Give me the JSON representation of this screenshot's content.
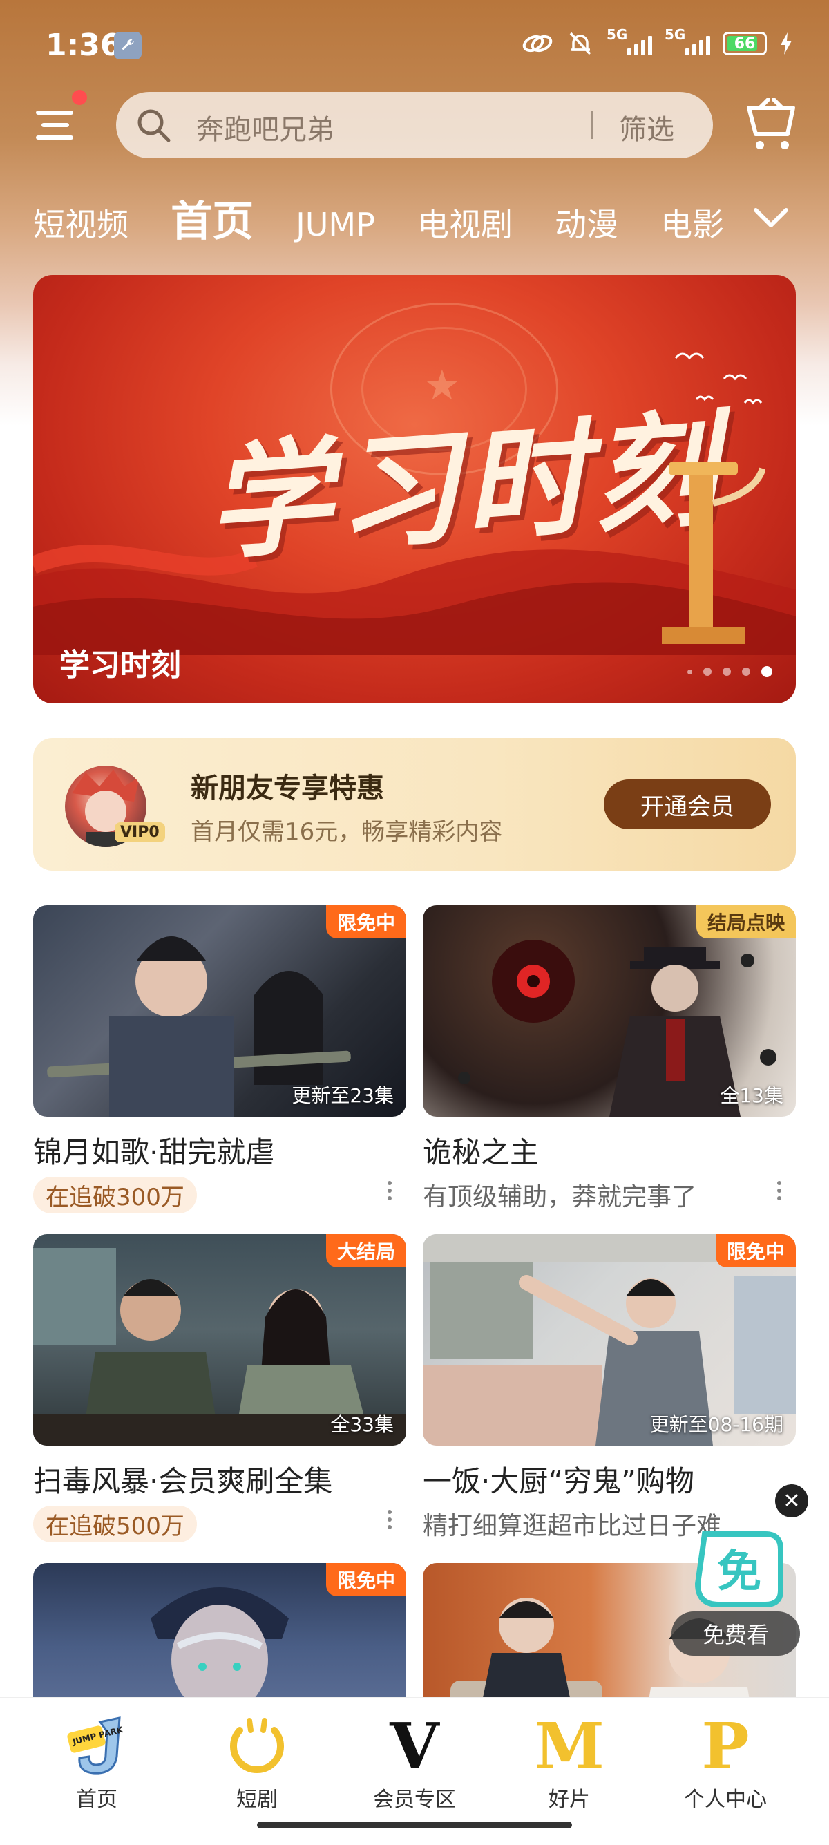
{
  "status_bar": {
    "time": "1:36",
    "net1": "5G",
    "net2": "5G",
    "battery": "66"
  },
  "header": {
    "search_placeholder": "奔跑吧兄弟",
    "filter_label": "筛选"
  },
  "tabs": [
    "短视频",
    "首页",
    "JUMP",
    "电视剧",
    "动漫",
    "电影"
  ],
  "active_tab": "首页",
  "banner": {
    "title_art": "学习时刻",
    "caption": "学习时刻",
    "slide_count": 5,
    "active_slide": 5
  },
  "vip_promo": {
    "badge": "VIP0",
    "title": "新朋友专享特惠",
    "subtitle": "首月仅需16元，畅享精彩内容",
    "button": "开通会员"
  },
  "cards": [
    {
      "badge": "限免中",
      "episodes": "更新至23集",
      "title": "锦月如歌·甜完就虐",
      "tag": "在追破300万",
      "subtitle": ""
    },
    {
      "badge": "结局点映",
      "episodes": "全13集",
      "title": "诡秘之主",
      "tag": "",
      "subtitle": "有顶级辅助，莽就完事了"
    },
    {
      "badge": "大结局",
      "episodes": "全33集",
      "title": "扫毒风暴·会员爽刷全集",
      "tag": "在追破500万",
      "subtitle": ""
    },
    {
      "badge": "限免中",
      "episodes": "更新至08-16期",
      "title": "一饭·大厨“穷鬼”购物",
      "tag": "",
      "subtitle": "精打细算逛超市比过日子难"
    },
    {
      "badge": "限免中",
      "episodes": "",
      "title": "",
      "tag": "",
      "subtitle": ""
    },
    {
      "badge": "",
      "episodes": "",
      "title": "",
      "tag": "",
      "subtitle": ""
    }
  ],
  "float_ad": {
    "icon_text": "免",
    "label": "免费看"
  },
  "bottom_nav": [
    {
      "label": "首页",
      "icon": "jump-park-icon",
      "icon_text": "JUMP PARK"
    },
    {
      "label": "短剧",
      "icon": "short-drama-icon"
    },
    {
      "label": "会员专区",
      "icon": "vip-v-icon",
      "icon_text": "V"
    },
    {
      "label": "好片",
      "icon": "good-movies-m-icon",
      "icon_text": "M"
    },
    {
      "label": "个人中心",
      "icon": "profile-p-icon",
      "icon_text": "P"
    }
  ],
  "colors": {
    "header_bg": "#b8763c",
    "accent_orange": "#ff6a1a",
    "vip_button": "#7a3e15",
    "nav_yellow": "#f2c12e"
  }
}
